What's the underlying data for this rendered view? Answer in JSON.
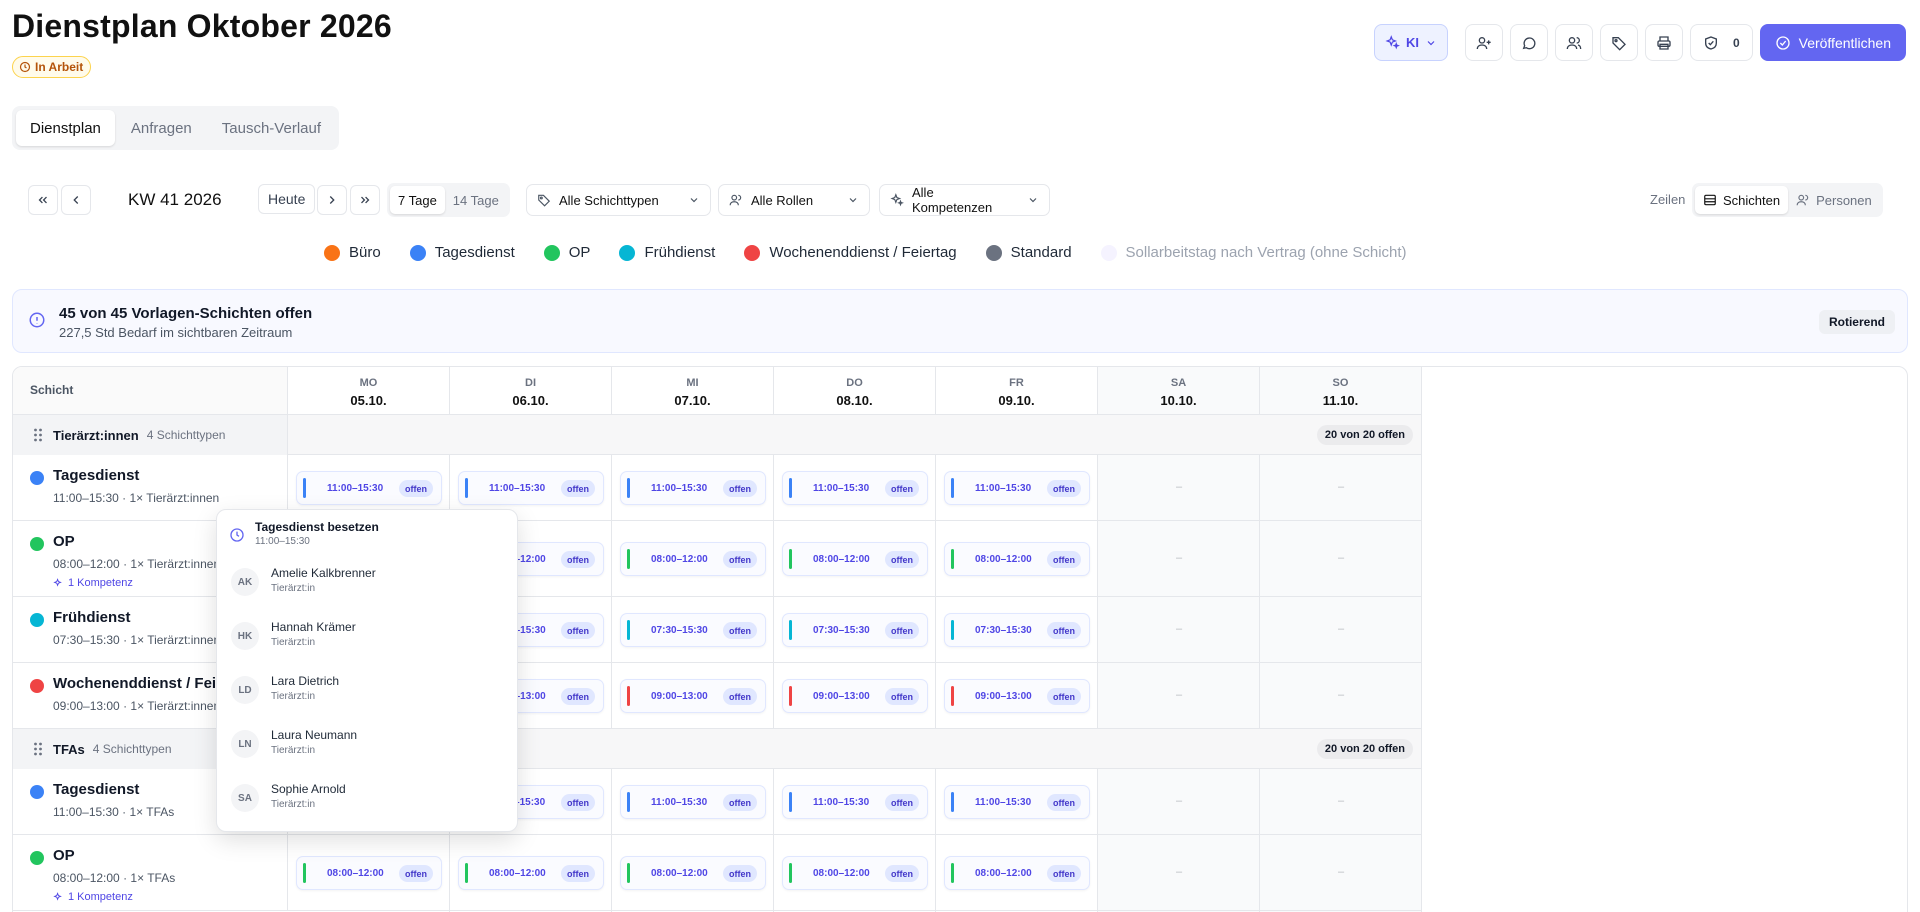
{
  "header": {
    "title": "Dienstplan Oktober 2026",
    "status": "In Arbeit",
    "ki_label": "KI",
    "check_count": "0",
    "publish_label": "Veröffentlichen"
  },
  "tabs": [
    {
      "label": "Dienstplan"
    },
    {
      "label": "Anfragen"
    },
    {
      "label": "Tausch-Verlauf"
    }
  ],
  "toolbar": {
    "week": "KW 41 2026",
    "today": "Heute",
    "range_7": "7 Tage",
    "range_14": "14 Tage",
    "filter_shift_types": "Alle Schichttypen",
    "filter_roles": "Alle Rollen",
    "filter_competences": "Alle Kompetenzen",
    "rows_label": "Zeilen",
    "view_shifts": "Schichten",
    "view_persons": "Personen"
  },
  "legend": [
    {
      "label": "Büro",
      "color": "#f97316"
    },
    {
      "label": "Tagesdienst",
      "color": "#3b82f6"
    },
    {
      "label": "OP",
      "color": "#22c55e"
    },
    {
      "label": "Frühdienst",
      "color": "#06b6d4"
    },
    {
      "label": "Wochenenddienst / Feiertag",
      "color": "#ef4444"
    },
    {
      "label": "Standard",
      "color": "#6b7280"
    },
    {
      "label": "Sollarbeitstag nach Vertrag (ohne Schicht)",
      "color": "#f5f3ff"
    }
  ],
  "banner": {
    "title": "45 von 45 Vorlagen-Schichten offen",
    "subtitle": "227,5 Std Bedarf im sichtbaren Zeitraum",
    "badge": "Rotierend"
  },
  "grid": {
    "shift_header": "Schicht",
    "open_label": "offen",
    "empty": "–",
    "days": [
      {
        "name": "MO",
        "date": "05.10."
      },
      {
        "name": "DI",
        "date": "06.10."
      },
      {
        "name": "MI",
        "date": "07.10."
      },
      {
        "name": "DO",
        "date": "08.10."
      },
      {
        "name": "FR",
        "date": "09.10."
      },
      {
        "name": "SA",
        "date": "10.10."
      },
      {
        "name": "SO",
        "date": "11.10."
      }
    ],
    "groups": [
      {
        "name": "Tierärzt:innen",
        "count": "4 Schichttypen",
        "badge": "20 von 20 offen",
        "shifts": [
          {
            "name": "Tagesdienst",
            "meta": "11:00–15:30 · 1× Tierärzt:innen",
            "time": "11:00–15:30",
            "color": "#3b82f6",
            "komp": ""
          },
          {
            "name": "OP",
            "meta": "08:00–12:00 · 1× Tierärzt:innen",
            "time": "08:00–12:00",
            "color": "#22c55e",
            "komp": "1 Kompetenz"
          },
          {
            "name": "Frühdienst",
            "meta": "07:30–15:30 · 1× Tierärzt:innen",
            "time": "07:30–15:30",
            "color": "#06b6d4",
            "komp": ""
          },
          {
            "name": "Wochenenddienst / Feiertag",
            "meta": "09:00–13:00 · 1× Tierärzt:innen",
            "time": "09:00–13:00",
            "color": "#ef4444",
            "komp": ""
          }
        ]
      },
      {
        "name": "TFAs",
        "count": "4 Schichttypen",
        "badge": "20 von 20 offen",
        "shifts": [
          {
            "name": "Tagesdienst",
            "meta": "11:00–15:30 · 1× TFAs",
            "time": "11:00–15:30",
            "color": "#3b82f6",
            "komp": ""
          },
          {
            "name": "OP",
            "meta": "08:00–12:00 · 1× TFAs",
            "time": "08:00–12:00",
            "color": "#22c55e",
            "komp": "1 Kompetenz"
          }
        ]
      }
    ]
  },
  "popover": {
    "title": "Tagesdienst besetzen",
    "subtitle": "11:00–15:30",
    "people": [
      {
        "initials": "AK",
        "name": "Amelie Kalkbrenner",
        "role": "Tierärzt:in"
      },
      {
        "initials": "HK",
        "name": "Hannah Krämer",
        "role": "Tierärzt:in"
      },
      {
        "initials": "LD",
        "name": "Lara Dietrich",
        "role": "Tierärzt:in"
      },
      {
        "initials": "LN",
        "name": "Laura Neumann",
        "role": "Tierärzt:in"
      },
      {
        "initials": "SA",
        "name": "Sophie Arnold",
        "role": "Tierärzt:in"
      }
    ]
  }
}
